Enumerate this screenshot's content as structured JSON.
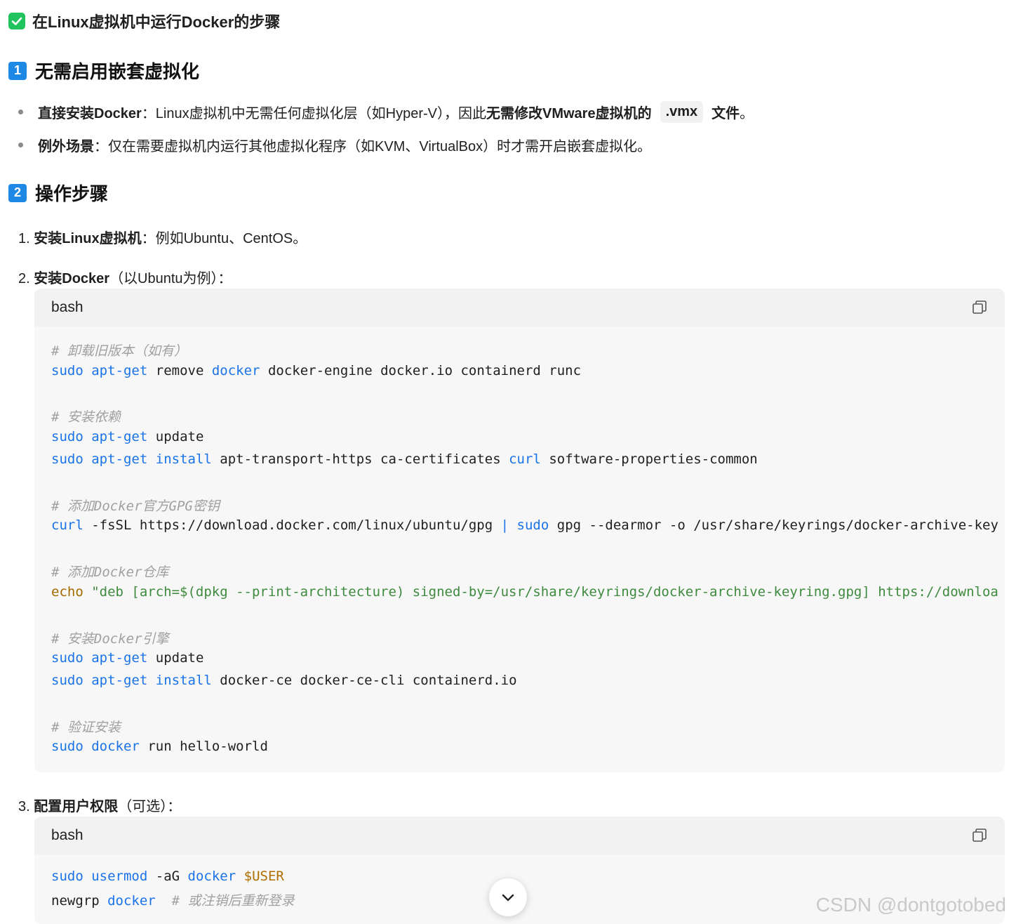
{
  "title": "在Linux虚拟机中运行Docker的步骤",
  "section1": {
    "num": "1",
    "heading": "无需启用嵌套虚拟化",
    "bullets": [
      {
        "bold": "直接安装Docker",
        "text": "：Linux虚拟机中无需任何虚拟化层（如Hyper-V），因此",
        "bold2": "无需修改VMware虚拟机的",
        "code": ".vmx",
        "bold3": "文件",
        "tail": "。"
      },
      {
        "bold": "例外场景",
        "text": "：仅在需要虚拟机内运行其他虚拟化程序（如KVM、VirtualBox）时才需开启嵌套虚拟化。"
      }
    ]
  },
  "section2": {
    "num": "2",
    "heading": "操作步骤",
    "steps": [
      {
        "n": "1.",
        "bold": "安装Linux虚拟机",
        "text": "：例如Ubuntu、CentOS。"
      },
      {
        "n": "2.",
        "bold": "安装Docker",
        "text": "（以Ubuntu为例）："
      },
      {
        "n": "3.",
        "bold": "配置用户权限",
        "text": "（可选）："
      }
    ]
  },
  "code1": {
    "lang": "bash",
    "comments": [
      "# 卸载旧版本（如有）",
      "# 安装依赖",
      "# 添加Docker官方GPG密钥",
      "# 添加Docker仓库",
      "# 安装Docker引擎",
      "# 验证安装"
    ],
    "l1": [
      "sudo",
      "apt-get",
      "remove",
      "docker",
      "docker-engine docker.io containerd runc"
    ],
    "l2": [
      "sudo",
      "apt-get",
      "update"
    ],
    "l3": [
      "sudo",
      "apt-get",
      "install",
      "apt-transport-https ca-certificates",
      "curl",
      "software-properties-common"
    ],
    "l4": [
      "curl",
      "-fsSL https://download.docker.com/linux/ubuntu/gpg",
      "|",
      "sudo",
      "gpg --dearmor -o /usr/share/keyrings/docker-archive-key"
    ],
    "l5": [
      "echo",
      "\"deb [arch=$(dpkg --print-architecture) signed-by=/usr/share/keyrings/docker-archive-keyring.gpg] https://downloa"
    ],
    "l6": [
      "sudo",
      "apt-get",
      "update"
    ],
    "l7": [
      "sudo",
      "apt-get",
      "install",
      "docker-ce docker-ce-cli containerd.io"
    ],
    "l8": [
      "sudo",
      "docker",
      "run hello-world"
    ]
  },
  "code2": {
    "lang": "bash",
    "l1": [
      "sudo",
      "usermod",
      "-aG",
      "docker",
      "$USER"
    ],
    "l2": [
      "newgrp",
      "docker",
      "# 或注销后重新登录"
    ]
  },
  "watermark": "CSDN @dontgotobed"
}
